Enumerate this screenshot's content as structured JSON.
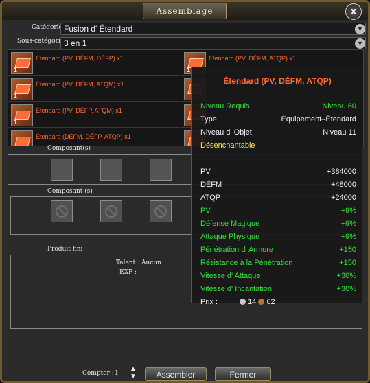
{
  "window": {
    "title": "Assemblage",
    "close_label": "x"
  },
  "category": {
    "label": "Catégorie",
    "value": "Fusion d' Étendard"
  },
  "subcategory": {
    "label": "Sous-catégorie",
    "value": "3 en 1"
  },
  "recipes": [
    {
      "name": "Étendard (PV, DÉFM, DÉFP) x1",
      "qty": "1"
    },
    {
      "name": "Étendard (PV, DÉFM, ATQP) x1",
      "qty": "1"
    },
    {
      "name": "Étendard (PV, DÉFM, ATQM) x1",
      "qty": "1"
    },
    {
      "name": "",
      "qty": ""
    },
    {
      "name": "Étendard (PV, DÉFP, ATQM) x1",
      "qty": "1"
    },
    {
      "name": "",
      "qty": ""
    },
    {
      "name": "Étendard (DÉFM, DÉFP, ATQP) x1",
      "qty": "1"
    },
    {
      "name": "",
      "qty": ""
    }
  ],
  "sections": {
    "composants1": "Composant(s)",
    "composants2": "Composant (s)",
    "produit": "Produit fini"
  },
  "produit": {
    "talent_label": "Talent : Aucun",
    "exp_label": "EXP :"
  },
  "footer": {
    "count_label": "Compter :",
    "count_value": "1",
    "assemble": "Assembler",
    "close": "Fermer"
  },
  "tooltip": {
    "title": "Étendard (PV, DÉFM, ATQP)",
    "info": [
      {
        "k": "Niveau Requis",
        "v": "Niveau 60",
        "color": "green"
      },
      {
        "k": "Type",
        "v": "Équipement–Étendard",
        "color": "white"
      },
      {
        "k": "Niveau d' Objet",
        "v": "Niveau 11",
        "color": "white"
      }
    ],
    "desenchantable": "Désenchantable",
    "base_stats": [
      {
        "k": "PV",
        "v": "+384000"
      },
      {
        "k": "DÉFM",
        "v": "+48000"
      },
      {
        "k": "ATQP",
        "v": "+24000"
      }
    ],
    "bonus_stats": [
      {
        "k": "PV",
        "v": "+9%"
      },
      {
        "k": "Défense Magique",
        "v": "+9%"
      },
      {
        "k": "Attaque Physique",
        "v": "+9%"
      },
      {
        "k": "Pénétration d' Armure",
        "v": "+150"
      },
      {
        "k": "Résistance à la Pénétration",
        "v": "+150"
      },
      {
        "k": "Vitesse d' Attaque",
        "v": "+30%"
      },
      {
        "k": "Vitesse d' Incantation",
        "v": "+30%"
      }
    ],
    "price_label": "Prix :",
    "price_silver": "14",
    "price_bronze": "62"
  },
  "colors": {
    "recipe_name": "#ff6a2f",
    "green": "#33e03a",
    "yellow": "#ffe14a"
  }
}
